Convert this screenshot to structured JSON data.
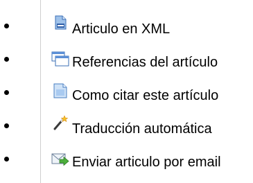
{
  "menu": {
    "items": [
      {
        "label": "Articulo en XML",
        "icon": "xml-document-icon"
      },
      {
        "label": "Referencias del artículo",
        "icon": "references-windows-icon"
      },
      {
        "label": "Como citar este artículo",
        "icon": "cite-document-icon"
      },
      {
        "label": "Traducción automática",
        "icon": "magic-wand-icon"
      },
      {
        "label": "Enviar articulo por email",
        "icon": "email-send-icon"
      }
    ]
  }
}
